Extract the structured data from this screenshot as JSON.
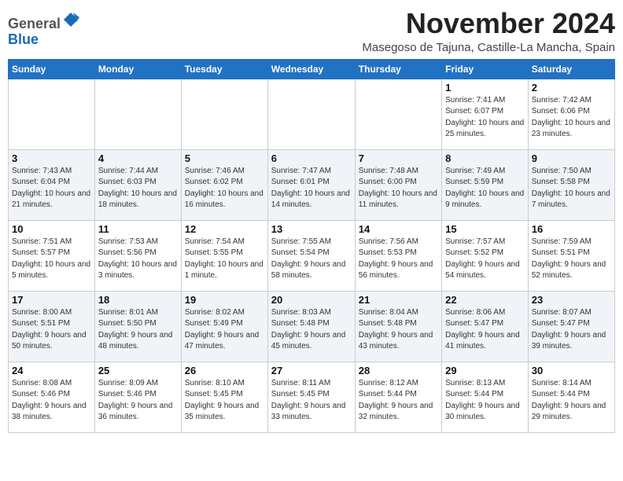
{
  "header": {
    "logo_general": "General",
    "logo_blue": "Blue",
    "month_title": "November 2024",
    "location": "Masegoso de Tajuna, Castille-La Mancha, Spain"
  },
  "weekdays": [
    "Sunday",
    "Monday",
    "Tuesday",
    "Wednesday",
    "Thursday",
    "Friday",
    "Saturday"
  ],
  "weeks": [
    [
      {
        "day": "",
        "info": ""
      },
      {
        "day": "",
        "info": ""
      },
      {
        "day": "",
        "info": ""
      },
      {
        "day": "",
        "info": ""
      },
      {
        "day": "",
        "info": ""
      },
      {
        "day": "1",
        "info": "Sunrise: 7:41 AM\nSunset: 6:07 PM\nDaylight: 10 hours and 25 minutes."
      },
      {
        "day": "2",
        "info": "Sunrise: 7:42 AM\nSunset: 6:06 PM\nDaylight: 10 hours and 23 minutes."
      }
    ],
    [
      {
        "day": "3",
        "info": "Sunrise: 7:43 AM\nSunset: 6:04 PM\nDaylight: 10 hours and 21 minutes."
      },
      {
        "day": "4",
        "info": "Sunrise: 7:44 AM\nSunset: 6:03 PM\nDaylight: 10 hours and 18 minutes."
      },
      {
        "day": "5",
        "info": "Sunrise: 7:46 AM\nSunset: 6:02 PM\nDaylight: 10 hours and 16 minutes."
      },
      {
        "day": "6",
        "info": "Sunrise: 7:47 AM\nSunset: 6:01 PM\nDaylight: 10 hours and 14 minutes."
      },
      {
        "day": "7",
        "info": "Sunrise: 7:48 AM\nSunset: 6:00 PM\nDaylight: 10 hours and 11 minutes."
      },
      {
        "day": "8",
        "info": "Sunrise: 7:49 AM\nSunset: 5:59 PM\nDaylight: 10 hours and 9 minutes."
      },
      {
        "day": "9",
        "info": "Sunrise: 7:50 AM\nSunset: 5:58 PM\nDaylight: 10 hours and 7 minutes."
      }
    ],
    [
      {
        "day": "10",
        "info": "Sunrise: 7:51 AM\nSunset: 5:57 PM\nDaylight: 10 hours and 5 minutes."
      },
      {
        "day": "11",
        "info": "Sunrise: 7:53 AM\nSunset: 5:56 PM\nDaylight: 10 hours and 3 minutes."
      },
      {
        "day": "12",
        "info": "Sunrise: 7:54 AM\nSunset: 5:55 PM\nDaylight: 10 hours and 1 minute."
      },
      {
        "day": "13",
        "info": "Sunrise: 7:55 AM\nSunset: 5:54 PM\nDaylight: 9 hours and 58 minutes."
      },
      {
        "day": "14",
        "info": "Sunrise: 7:56 AM\nSunset: 5:53 PM\nDaylight: 9 hours and 56 minutes."
      },
      {
        "day": "15",
        "info": "Sunrise: 7:57 AM\nSunset: 5:52 PM\nDaylight: 9 hours and 54 minutes."
      },
      {
        "day": "16",
        "info": "Sunrise: 7:59 AM\nSunset: 5:51 PM\nDaylight: 9 hours and 52 minutes."
      }
    ],
    [
      {
        "day": "17",
        "info": "Sunrise: 8:00 AM\nSunset: 5:51 PM\nDaylight: 9 hours and 50 minutes."
      },
      {
        "day": "18",
        "info": "Sunrise: 8:01 AM\nSunset: 5:50 PM\nDaylight: 9 hours and 48 minutes."
      },
      {
        "day": "19",
        "info": "Sunrise: 8:02 AM\nSunset: 5:49 PM\nDaylight: 9 hours and 47 minutes."
      },
      {
        "day": "20",
        "info": "Sunrise: 8:03 AM\nSunset: 5:48 PM\nDaylight: 9 hours and 45 minutes."
      },
      {
        "day": "21",
        "info": "Sunrise: 8:04 AM\nSunset: 5:48 PM\nDaylight: 9 hours and 43 minutes."
      },
      {
        "day": "22",
        "info": "Sunrise: 8:06 AM\nSunset: 5:47 PM\nDaylight: 9 hours and 41 minutes."
      },
      {
        "day": "23",
        "info": "Sunrise: 8:07 AM\nSunset: 5:47 PM\nDaylight: 9 hours and 39 minutes."
      }
    ],
    [
      {
        "day": "24",
        "info": "Sunrise: 8:08 AM\nSunset: 5:46 PM\nDaylight: 9 hours and 38 minutes."
      },
      {
        "day": "25",
        "info": "Sunrise: 8:09 AM\nSunset: 5:46 PM\nDaylight: 9 hours and 36 minutes."
      },
      {
        "day": "26",
        "info": "Sunrise: 8:10 AM\nSunset: 5:45 PM\nDaylight: 9 hours and 35 minutes."
      },
      {
        "day": "27",
        "info": "Sunrise: 8:11 AM\nSunset: 5:45 PM\nDaylight: 9 hours and 33 minutes."
      },
      {
        "day": "28",
        "info": "Sunrise: 8:12 AM\nSunset: 5:44 PM\nDaylight: 9 hours and 32 minutes."
      },
      {
        "day": "29",
        "info": "Sunrise: 8:13 AM\nSunset: 5:44 PM\nDaylight: 9 hours and 30 minutes."
      },
      {
        "day": "30",
        "info": "Sunrise: 8:14 AM\nSunset: 5:44 PM\nDaylight: 9 hours and 29 minutes."
      }
    ]
  ]
}
